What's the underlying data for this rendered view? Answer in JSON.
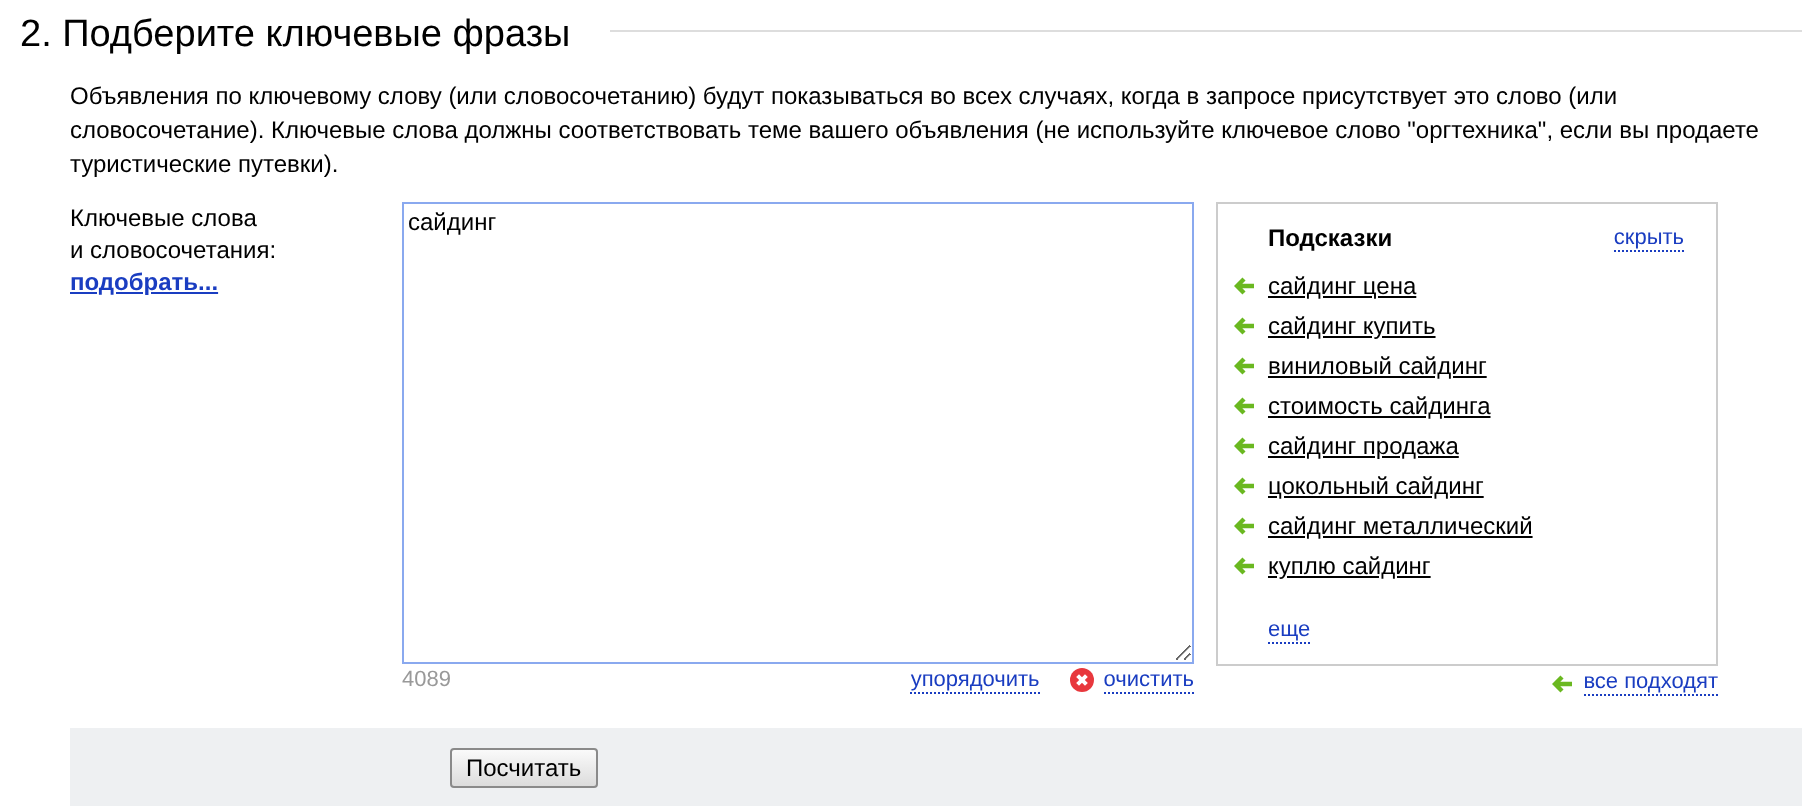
{
  "heading": "2. Подберите ключевые фразы",
  "description": "Объявления по ключевому слову (или словосочетанию) будут показываться во всех случаях, когда в запросе присутствует это слово (или словосочетание). Ключевые слова должны соответствовать теме вашего объявления (не используйте ключевое слово \"оргтехника\", если вы продаете туристические путевки).",
  "keywords": {
    "label_lines": [
      "Ключевые слова",
      "и словосочетания:"
    ],
    "pick_link": "подобрать...",
    "value": "сайдинг",
    "counter": "4089",
    "sort_link": "упорядочить",
    "clear_link": "очистить"
  },
  "suggestions": {
    "title": "Подсказки",
    "hide_link": "скрыть",
    "items": [
      {
        "label": "сайдинг цена"
      },
      {
        "label": "сайдинг купить"
      },
      {
        "label": "виниловый сайдинг"
      },
      {
        "label": "стоимость сайдинга"
      },
      {
        "label": "сайдинг продажа"
      },
      {
        "label": "цокольный сайдинг"
      },
      {
        "label": "сайдинг металлический"
      },
      {
        "label": "куплю сайдинг"
      }
    ],
    "more_link": "еще",
    "all_link": "все подходят"
  },
  "submit_button": "Посчитать"
}
